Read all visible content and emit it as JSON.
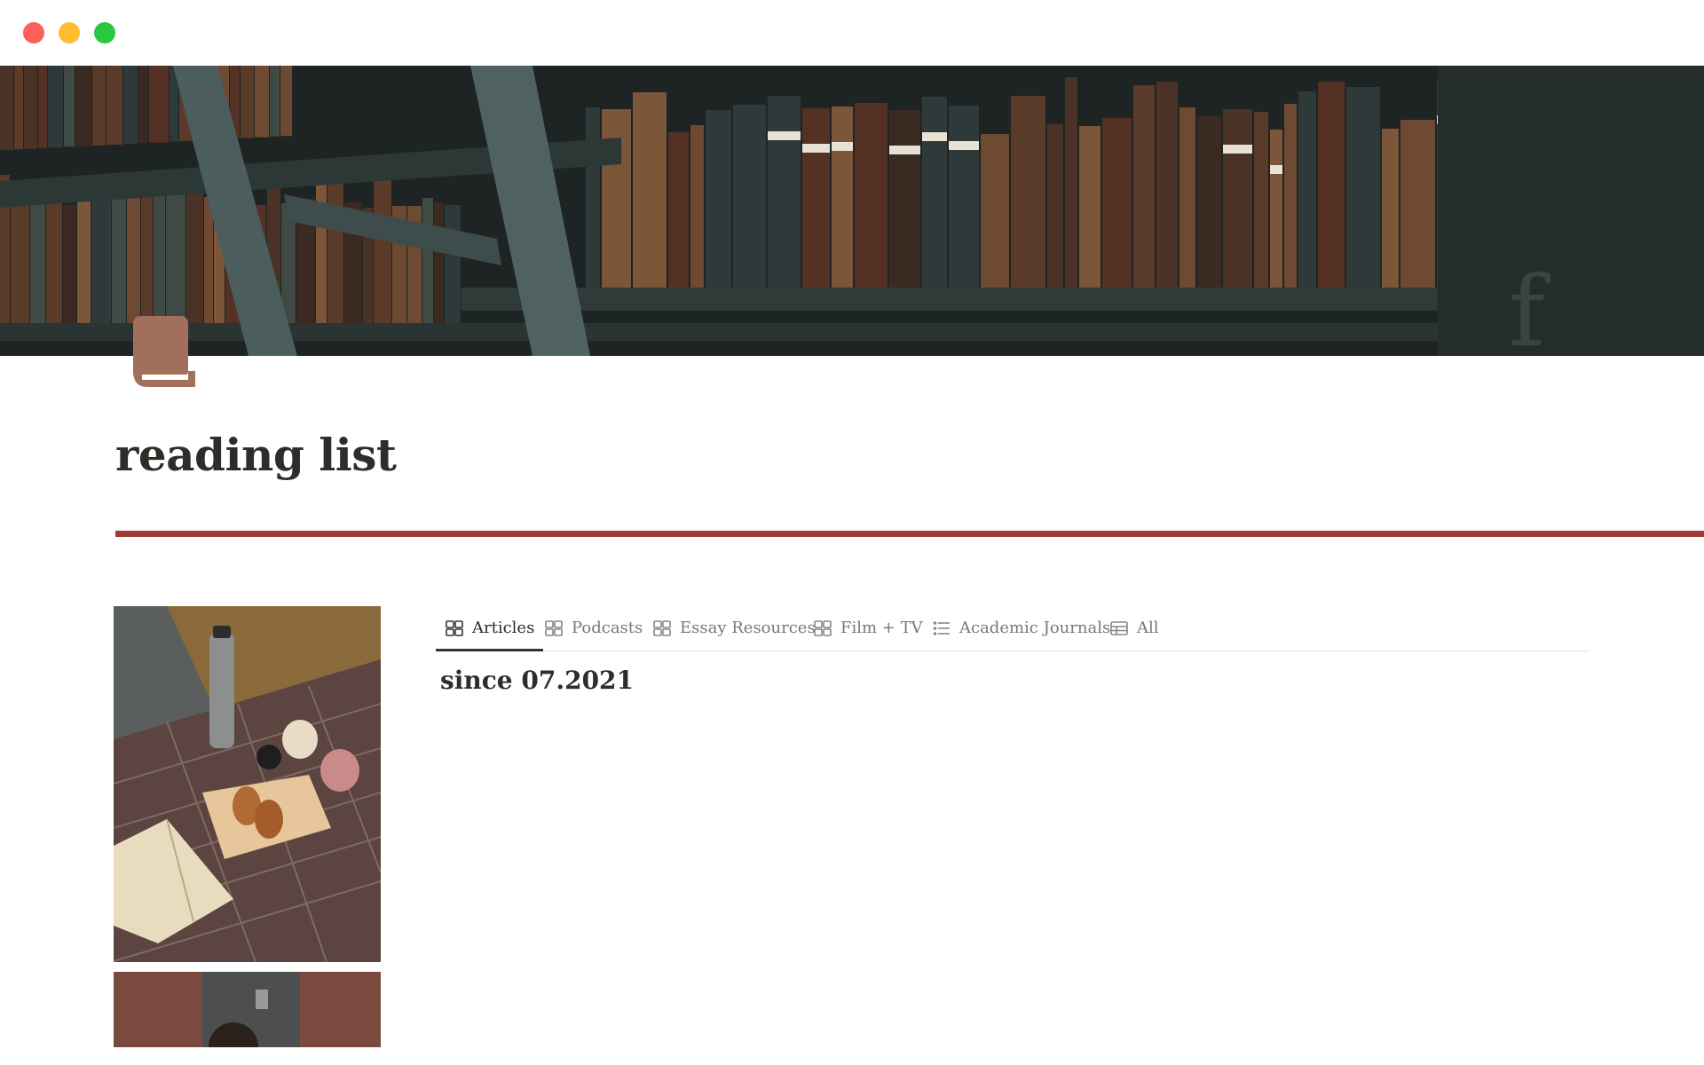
{
  "window": {
    "controls": [
      "close",
      "minimize",
      "zoom"
    ]
  },
  "page": {
    "title": "reading list",
    "icon": "book-icon",
    "accent_color": "#9f3a34",
    "icon_color": "#a26f5c"
  },
  "tabs": [
    {
      "label": "Articles",
      "icon": "gallery-icon",
      "active": true
    },
    {
      "label": "Podcasts",
      "icon": "gallery-icon",
      "active": false
    },
    {
      "label": "Essay Resources",
      "icon": "gallery-icon",
      "active": false
    },
    {
      "label": "Film + TV",
      "icon": "gallery-icon",
      "active": false
    },
    {
      "label": "Academic Journals",
      "icon": "list-icon",
      "active": false
    },
    {
      "label": "All",
      "icon": "table-icon",
      "active": false
    }
  ],
  "main": {
    "heading": "since 07.2021"
  }
}
